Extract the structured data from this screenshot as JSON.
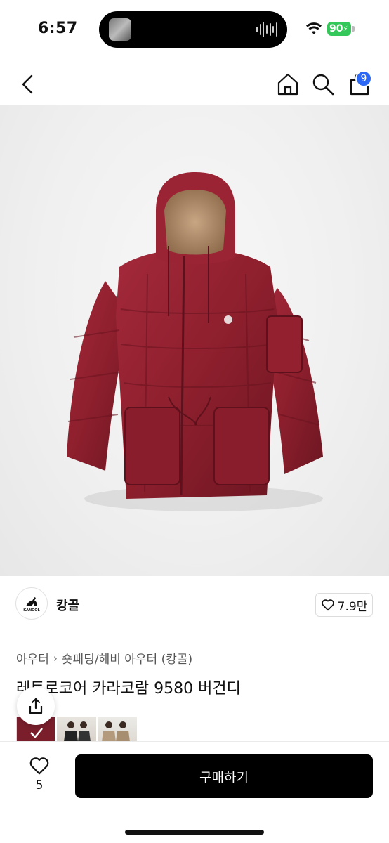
{
  "status": {
    "time": "6:57",
    "battery": "90"
  },
  "nav": {
    "back_icon": "chevron-left-icon",
    "home_icon": "home-icon",
    "search_icon": "search-icon",
    "cart_icon": "cart-icon",
    "cart_badge": "9"
  },
  "product": {
    "image_icon": "burgundy-padded-jacket-photo",
    "brand": "캉골",
    "brand_logo_text": "KANGOL",
    "likes": "7.9만",
    "breadcrumb": [
      "아우터",
      "숏패딩/헤비 아우터 (캉골)"
    ],
    "title": "레트로코어 카라코람 9580 버건디"
  },
  "bottom": {
    "wish_count": "5",
    "buy_label": "구매하기"
  },
  "colors": {
    "accent": "#2a68f5",
    "jacket": "#8e1f2d",
    "battery": "#34c759"
  }
}
